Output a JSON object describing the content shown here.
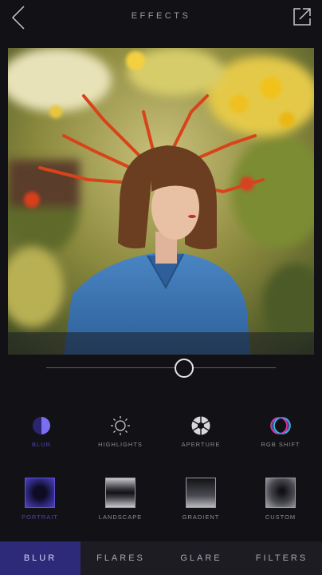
{
  "header": {
    "title": "EFFECTS",
    "back_icon": "chevron-left-icon",
    "share_icon": "share-export-icon"
  },
  "slider": {
    "value": 0.6
  },
  "effects": [
    {
      "label": "BLUR",
      "icon": "blur-icon",
      "active": true
    },
    {
      "label": "HIGHLIGHTS",
      "icon": "sun-icon",
      "active": false
    },
    {
      "label": "APERTURE",
      "icon": "aperture-icon",
      "active": false
    },
    {
      "label": "RGB SHIFT",
      "icon": "rgb-shift-icon",
      "active": false
    }
  ],
  "modes": [
    {
      "label": "PORTRAIT",
      "active": true
    },
    {
      "label": "LANDSCAPE",
      "active": false
    },
    {
      "label": "GRADIENT",
      "active": false
    },
    {
      "label": "CUSTOM",
      "active": false
    }
  ],
  "tabs": [
    {
      "label": "BLUR",
      "active": true
    },
    {
      "label": "FLARES",
      "active": false
    },
    {
      "label": "GLARE",
      "active": false
    },
    {
      "label": "FILTERS",
      "active": false
    }
  ],
  "colors": {
    "accent": "#4f43b0",
    "accent_tab": "#2e2a7a",
    "background": "#121216"
  }
}
